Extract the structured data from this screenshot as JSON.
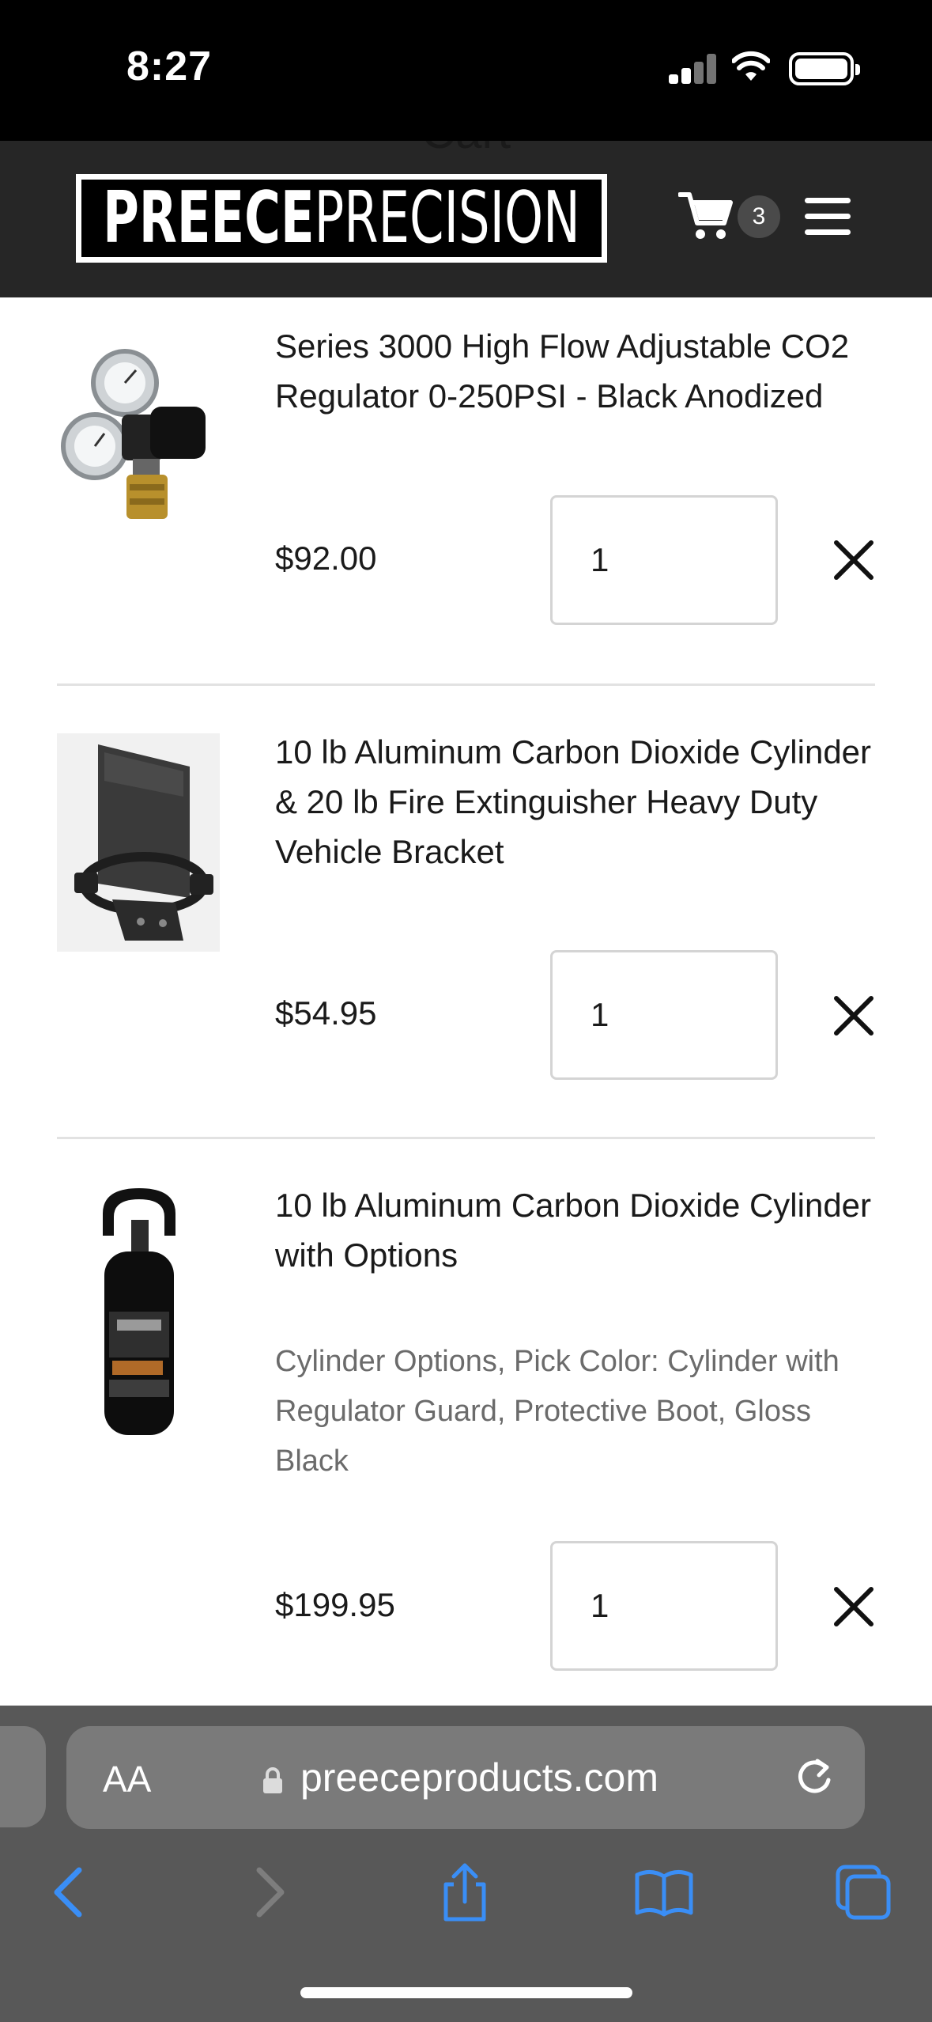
{
  "status_bar": {
    "time": "8:27"
  },
  "header": {
    "ghost_title": "Cart",
    "logo_part1": "PREECE",
    "logo_part2": "PRECISION",
    "cart_count": "3"
  },
  "cart": {
    "items": [
      {
        "name": "Series 3000 High Flow Adjustable CO2 Regulator 0-250PSI - Black Anodized",
        "options": "",
        "price": "$92.00",
        "quantity": "1"
      },
      {
        "name": "10 lb Aluminum Carbon Dioxide Cylinder & 20 lb Fire Extinguisher Heavy Duty Vehicle Bracket",
        "options": "",
        "price": "$54.95",
        "quantity": "1"
      },
      {
        "name": "10 lb Aluminum Carbon Dioxide Cylinder with Options",
        "options": "Cylinder Options, Pick Color:   Cylinder with Regulator Guard, Protective Boot, Gloss Black",
        "price": "$199.95",
        "quantity": "1"
      }
    ]
  },
  "browser": {
    "text_size_label": "AA",
    "url": "preeceproducts.com"
  },
  "colors": {
    "header_bg": "#262626",
    "browser_bg": "#585858",
    "toolbar_blue": "#3a8ef6"
  },
  "icons": {
    "cart": "cart-icon",
    "menu": "hamburger-menu-icon",
    "remove": "close-icon",
    "lock": "lock-icon",
    "reload": "reload-icon",
    "back": "chevron-left-icon",
    "forward": "chevron-right-icon",
    "share": "share-icon",
    "bookmarks": "book-icon",
    "tabs": "tabs-icon"
  }
}
